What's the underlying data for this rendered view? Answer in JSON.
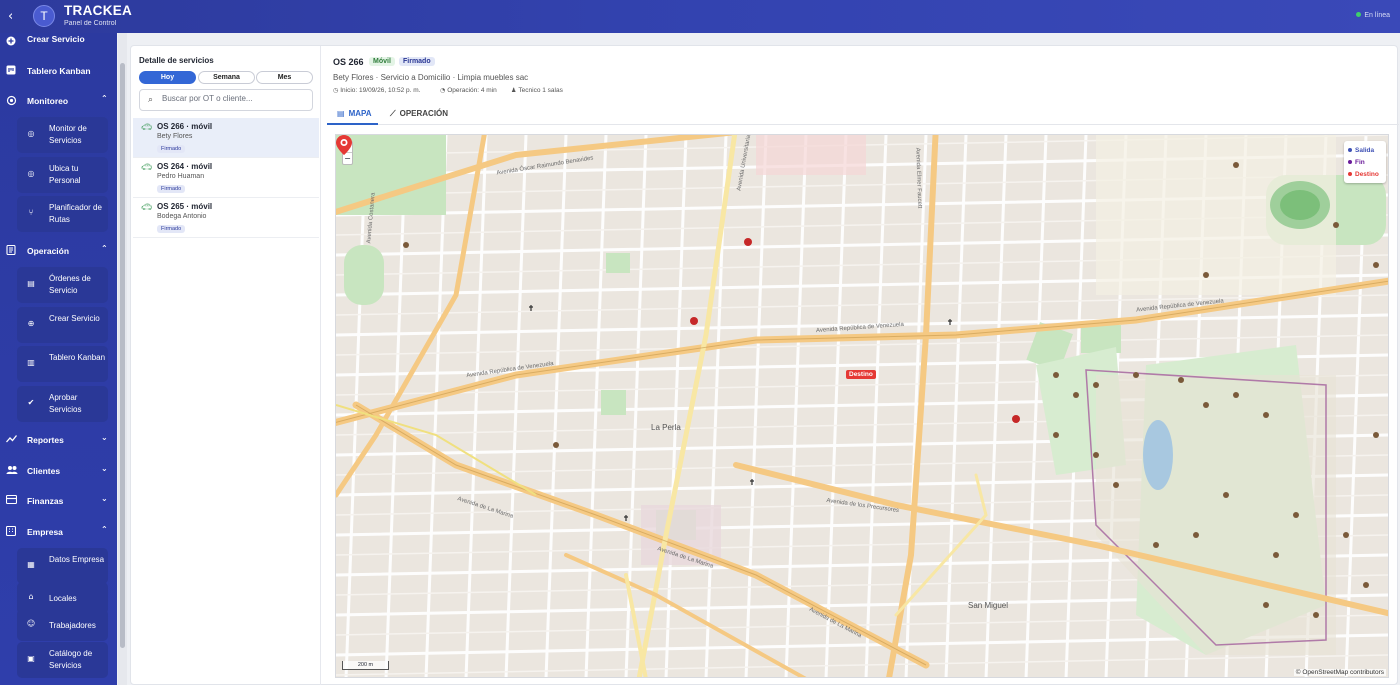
{
  "header": {
    "back": "‹",
    "logo_letter": "T",
    "brand": "TRACKEA",
    "subtitle": "Panel de Control",
    "status": "En línea"
  },
  "sidebar": {
    "crear_servicio": "Crear Servicio",
    "tablero_kanban": "Tablero Kanban",
    "monitoreo": "Monitoreo",
    "monitoreo_items": [
      "Monitor de Servicios",
      "Ubica tu Personal",
      "Planificador de Rutas"
    ],
    "operacion": "Operación",
    "operacion_items": [
      "Órdenes de Servicio",
      "Crear Servicio",
      "Tablero Kanban",
      "Aprobar Servicios"
    ],
    "reportes": "Reportes",
    "clientes": "Clientes",
    "finanzas": "Finanzas",
    "empresa": "Empresa",
    "empresa_items": [
      "Datos Empresa",
      "Locales",
      "Trabajadores",
      "Catálogo de Servicios"
    ]
  },
  "list": {
    "title": "Detalle de servicios",
    "filters": [
      "Hoy",
      "Semana",
      "Mes"
    ],
    "search_placeholder": "Buscar por OT o cliente...",
    "cards": [
      {
        "title": "OS 266 · móvil",
        "person": "Bety Flores",
        "tag": "Firmado"
      },
      {
        "title": "OS 264 · móvil",
        "person": "Pedro Huaman",
        "tag": "Firmado"
      },
      {
        "title": "OS 265 · móvil",
        "person": "Bodega Antonio",
        "tag": "Firmado"
      }
    ]
  },
  "detail": {
    "os": "OS 266",
    "badge_type": "Móvil",
    "badge_status": "Firmado",
    "line1": "Bety Flores · Servicio a Domicilio · Limpia muebles sac",
    "inicio": "Inicio: 19/09/26, 10:52 p. m.",
    "operacion": "Operación: 4 min",
    "tecnico": "Tecnico 1 salas",
    "tabs": [
      "MAPA",
      "OPERACIÓN"
    ]
  },
  "map": {
    "zoom_in": "+",
    "zoom_out": "−",
    "legend": [
      {
        "label": "Salida",
        "color": "#3f51b5"
      },
      {
        "label": "Fin",
        "color": "#6a1b9a"
      },
      {
        "label": "Destino",
        "color": "#e53935"
      }
    ],
    "destino_label": "Destino",
    "scale": "200 m",
    "attribution": "© OpenStreetMap contributors",
    "streets": {
      "venezuela_1": "Avenida República de Venezuela",
      "venezuela_2": "Avenida República de Venezuela",
      "venezuela_3": "Avenida República de Venezuela",
      "la_marina_1": "Avenida de La Marina",
      "la_marina_2": "Avenida de La Marina",
      "la_marina_3": "Avenida de La Marina",
      "precursores": "Avenida de los Precursores",
      "elmer_faucett": "Avenida Elmer Faucett",
      "oscar_benavides": "Avenida Óscar Raimundo Benavides",
      "universitaria": "Avenida Universitaria",
      "costanera": "Avenida Costanera"
    },
    "districts": [
      "La Perla",
      "San Miguel"
    ]
  }
}
